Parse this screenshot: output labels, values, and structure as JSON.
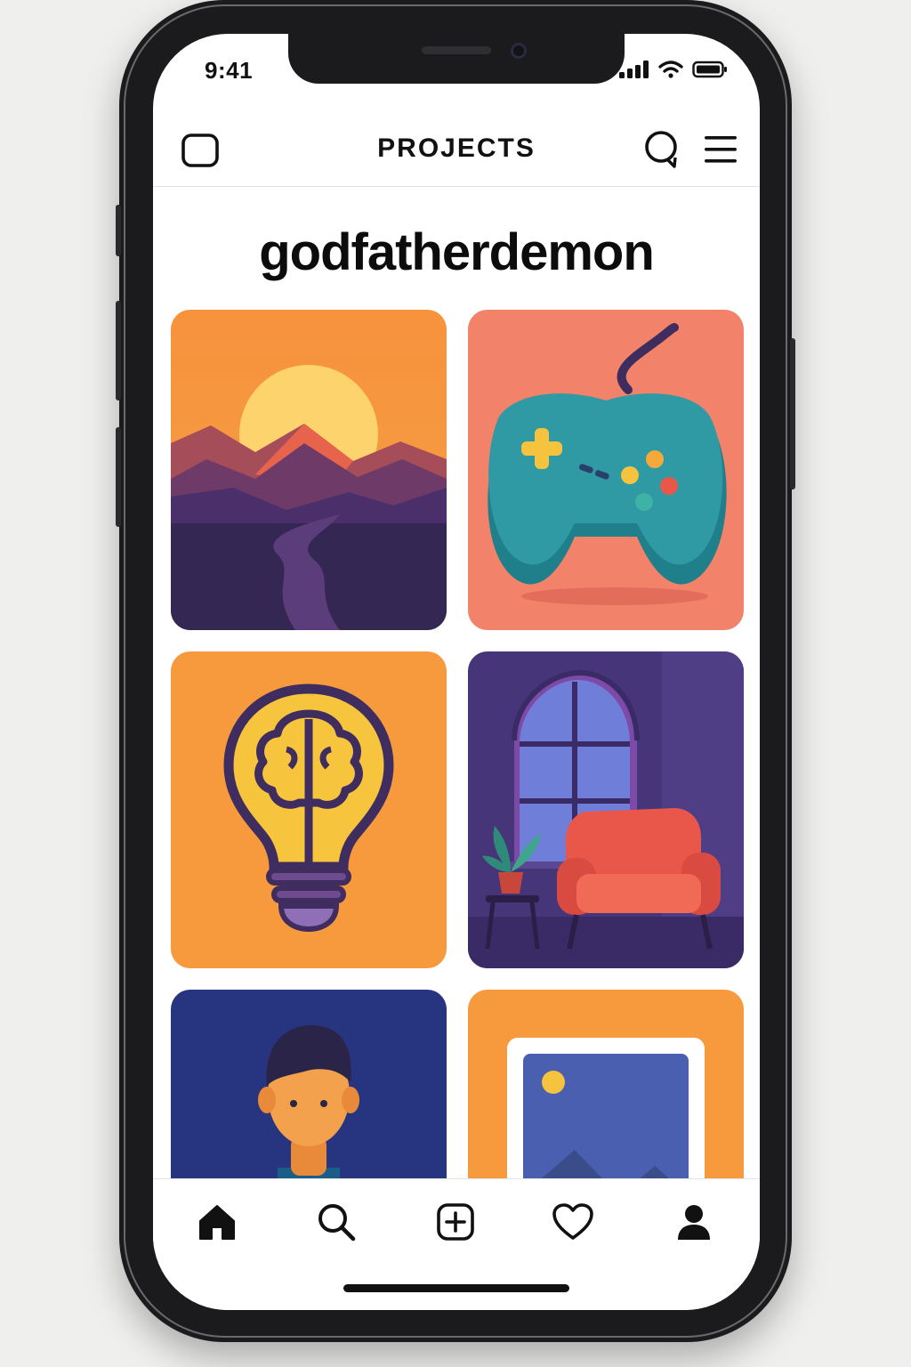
{
  "status_bar": {
    "time": "9:41"
  },
  "header": {
    "title": "PROJECTS"
  },
  "profile": {
    "username": "godfatherdemon"
  },
  "projects": [
    {
      "icon": "mountain-sunset-icon"
    },
    {
      "icon": "game-controller-icon"
    },
    {
      "icon": "lightbulb-brain-icon"
    },
    {
      "icon": "armchair-room-icon"
    },
    {
      "icon": "person-portrait-icon"
    },
    {
      "icon": "image-frame-icon"
    }
  ],
  "tabs": [
    "home-icon",
    "search-icon",
    "add-post-icon",
    "heart-icon",
    "profile-icon"
  ],
  "colors": {
    "orange": "#f79a3e",
    "salmon": "#f2826a",
    "purple": "#463579",
    "navy": "#27347f",
    "teal": "#2f9aa3"
  }
}
